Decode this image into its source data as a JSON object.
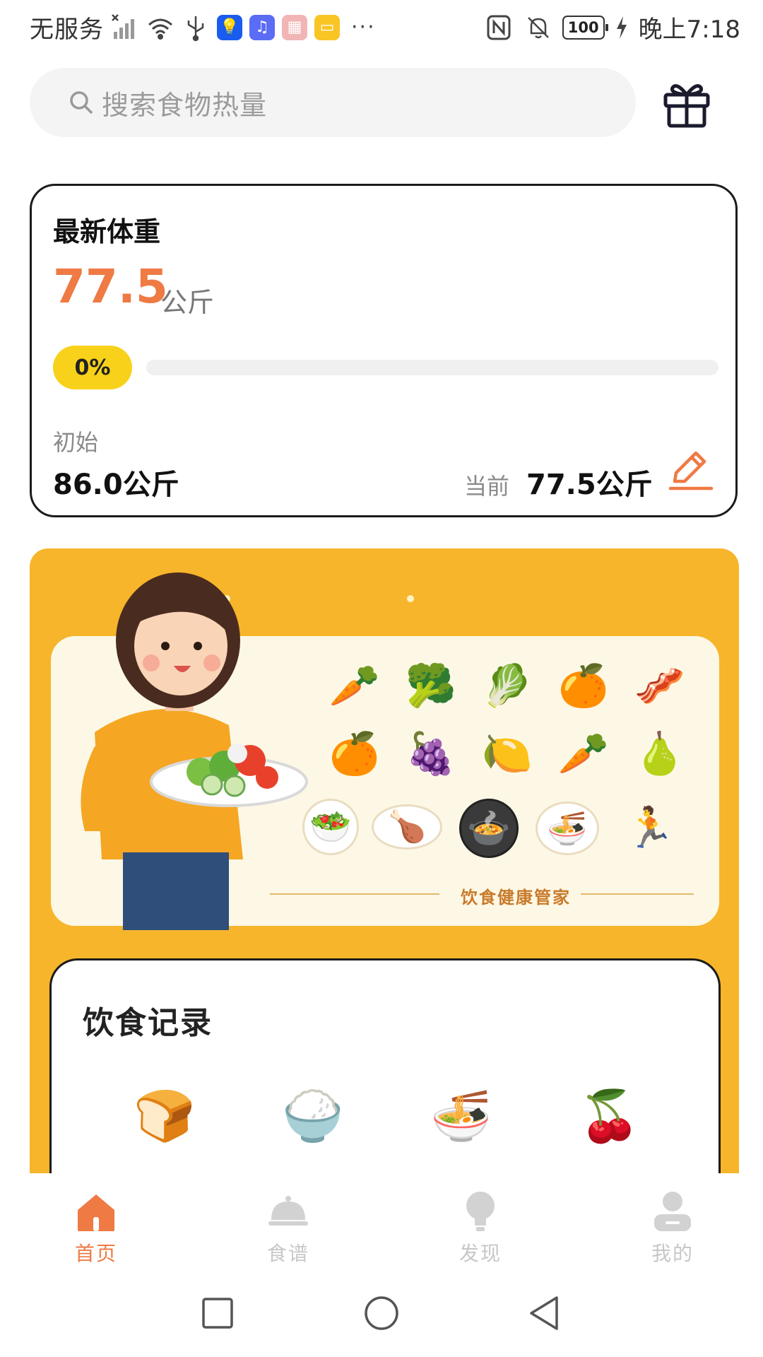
{
  "status_bar": {
    "carrier": "无服务",
    "time": "晚上7:18",
    "battery": "100",
    "overflow": "···",
    "icons": [
      "signal-x-icon",
      "wifi-icon",
      "usb-icon",
      "bulb-app-icon",
      "music-app-icon",
      "calendar-app-icon",
      "files-app-icon",
      "nfc-icon",
      "mute-bell-icon",
      "charging-icon"
    ]
  },
  "search": {
    "placeholder": "搜索食物热量",
    "icons": [
      "search-icon",
      "gift-icon"
    ]
  },
  "weight_card": {
    "title": "最新体重",
    "value": "77.5",
    "unit": "公斤",
    "progress_label": "0%",
    "progress": 0,
    "initial_label": "初始",
    "initial_value": "86.0公斤",
    "current_label": "当前",
    "current_value": "77.5公斤",
    "edit_icon": "pencil-icon"
  },
  "banner": {
    "caption": "饮食健康管家",
    "foods": [
      "🥕",
      "🥦",
      "🥬",
      "🍊",
      "🥓",
      "🍊",
      "🍇",
      "🍋",
      "🥕",
      "🍐",
      "🥗",
      "🍗",
      "🍲",
      "🍜",
      "🏃"
    ],
    "girl": "👩",
    "salad": "🥗",
    "colors": {
      "background": "#f7b52b",
      "panel": "#fdf8e6"
    }
  },
  "diet_record": {
    "title": "饮食记录",
    "meals": [
      {
        "name": "toast-icon",
        "glyph": "🍞"
      },
      {
        "name": "rice-bowl-icon",
        "glyph": "🍚"
      },
      {
        "name": "noodles-icon",
        "glyph": "🍜"
      },
      {
        "name": "cherry-icon",
        "glyph": "🍒"
      }
    ]
  },
  "tabbar": {
    "tabs": [
      {
        "label": "首页",
        "icon": "home-icon",
        "active": true
      },
      {
        "label": "食谱",
        "icon": "cloche-icon",
        "active": false
      },
      {
        "label": "发现",
        "icon": "bulb-icon",
        "active": false
      },
      {
        "label": "我的",
        "icon": "user-icon",
        "active": false
      }
    ],
    "colors": {
      "active": "#ef7a44",
      "inactive": "#c7c7c7"
    }
  },
  "system_nav": {
    "buttons": [
      "recent-apps-button",
      "home-button",
      "back-button"
    ]
  }
}
